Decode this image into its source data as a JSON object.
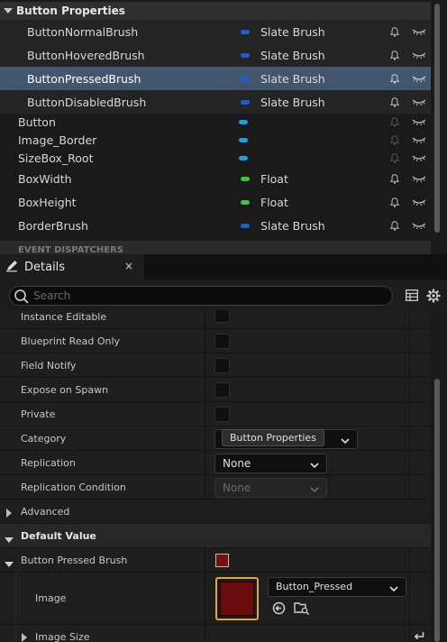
{
  "variables_panel": {
    "category": "Button Properties",
    "sub_items": [
      {
        "name": "ButtonNormalBrush",
        "type": "Slate Brush",
        "color": "#1a5fd6"
      },
      {
        "name": "ButtonHoveredBrush",
        "type": "Slate Brush",
        "color": "#1a5fd6"
      },
      {
        "name": "ButtonPressedBrush",
        "type": "Slate Brush",
        "color": "#1a5fd6",
        "selected": true
      },
      {
        "name": "ButtonDisabledBrush",
        "type": "Slate Brush",
        "color": "#1a5fd6"
      }
    ],
    "items": [
      {
        "name": "Button",
        "type": "",
        "color": "#11a3e8"
      },
      {
        "name": "Image_Border",
        "type": "",
        "color": "#11a3e8"
      },
      {
        "name": "SizeBox_Root",
        "type": "",
        "color": "#11a3e8"
      },
      {
        "name": "BoxWidth",
        "type": "Float",
        "color": "#3cc43c"
      },
      {
        "name": "BoxHeight",
        "type": "Float",
        "color": "#3cc43c"
      },
      {
        "name": "BorderBrush",
        "type": "Slate Brush",
        "color": "#1a5fd6"
      }
    ],
    "next_category": "EVENT DISPATCHERS"
  },
  "details_tab": {
    "title": "Details",
    "close": "×",
    "search_placeholder": "Search"
  },
  "details": {
    "rows": [
      {
        "label": "Instance Editable"
      },
      {
        "label": "Blueprint Read Only"
      },
      {
        "label": "Field Notify"
      },
      {
        "label": "Expose on Spawn"
      },
      {
        "label": "Private"
      }
    ],
    "category_label": "Category",
    "category_value": "Button Properties",
    "replication_label": "Replication",
    "replication_value": "None",
    "replication_condition_label": "Replication Condition",
    "replication_condition_value": "None",
    "advanced_label": "Advanced",
    "default_value_label": "Default Value",
    "brush_label": "Button Pressed Brush",
    "brush_color": "#7a0e0e",
    "image_label": "Image",
    "image_asset": "Button_Pressed",
    "image_size_label": "Image Size"
  }
}
